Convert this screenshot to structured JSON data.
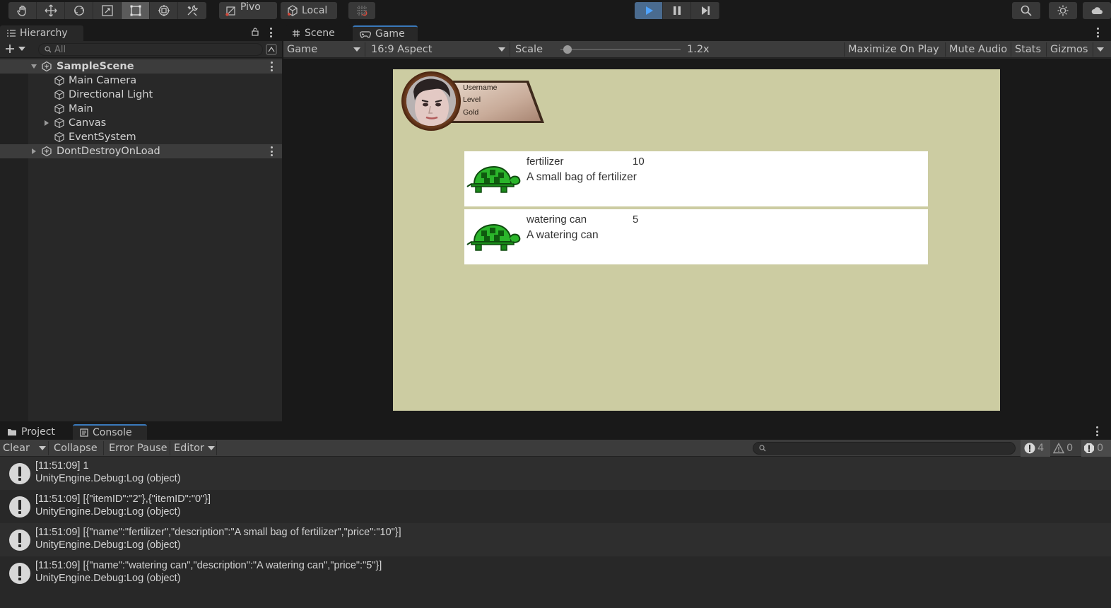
{
  "toolbar": {
    "pivot_label": "Pivo",
    "local_label": "Local"
  },
  "hierarchy": {
    "tab_label": "Hierarchy",
    "search_placeholder": "All",
    "items": [
      {
        "label": "SampleScene",
        "kind": "scene"
      },
      {
        "label": "Main Camera",
        "kind": "object"
      },
      {
        "label": "Directional Light",
        "kind": "object"
      },
      {
        "label": "Main",
        "kind": "object"
      },
      {
        "label": "Canvas",
        "kind": "object"
      },
      {
        "label": "EventSystem",
        "kind": "object"
      },
      {
        "label": "DontDestroyOnLoad",
        "kind": "scene"
      }
    ]
  },
  "gameview": {
    "tabs": [
      {
        "label": "Scene"
      },
      {
        "label": "Game"
      }
    ],
    "display_select": "Game",
    "aspect_select": "16:9 Aspect",
    "scale_label": "Scale",
    "scale_value": "1.2x",
    "scale_fraction": 0.03,
    "maximize_label": "Maximize On Play",
    "mute_label": "Mute Audio",
    "stats_label": "Stats",
    "gizmos_label": "Gizmos",
    "canvas_bg": "#cccca2",
    "player": {
      "username_label": "Username",
      "level_label": "Level",
      "gold_label": "Gold"
    },
    "items": [
      {
        "name": "fertilizer",
        "price": "10",
        "description": "A small bag of fertilizer"
      },
      {
        "name": "watering can",
        "price": "5",
        "description": "A watering can"
      }
    ]
  },
  "console": {
    "tabs": [
      {
        "label": "Project"
      },
      {
        "label": "Console"
      }
    ],
    "clear_label": "Clear",
    "collapse_label": "Collapse",
    "error_pause_label": "Error Pause",
    "editor_label": "Editor",
    "count_info": "4",
    "count_warn": "0",
    "count_error": "0",
    "logs": [
      {
        "line1": "[11:51:09] 1",
        "line2": "UnityEngine.Debug:Log (object)"
      },
      {
        "line1": "[11:51:09] [{\"itemID\":\"2\"},{\"itemID\":\"0\"}]",
        "line2": "UnityEngine.Debug:Log (object)"
      },
      {
        "line1": "[11:51:09] [{\"name\":\"fertilizer\",\"description\":\"A small bag of fertilizer\",\"price\":\"10\"}]",
        "line2": "UnityEngine.Debug:Log (object)"
      },
      {
        "line1": "[11:51:09] [{\"name\":\"watering can\",\"description\":\"A watering can\",\"price\":\"5\"}]",
        "line2": "UnityEngine.Debug:Log (object)"
      }
    ]
  }
}
